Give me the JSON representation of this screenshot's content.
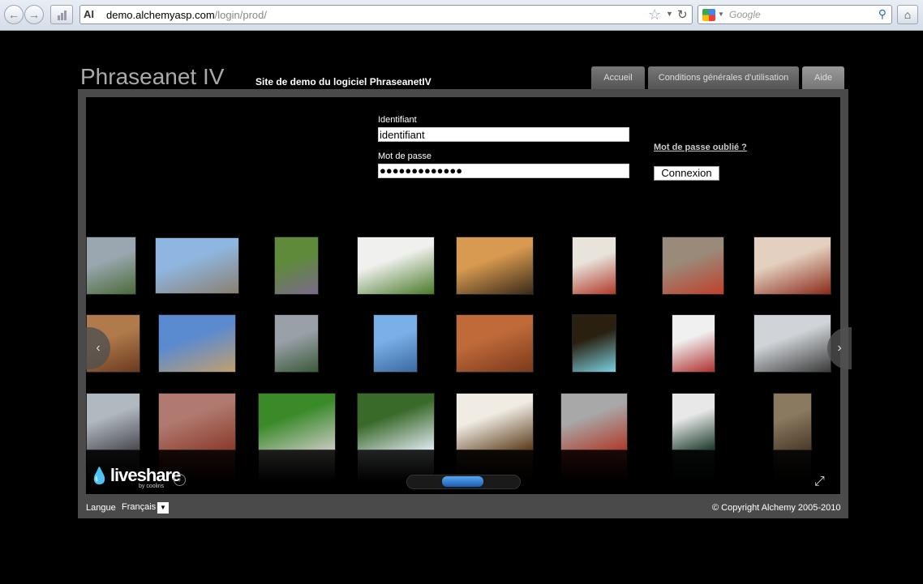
{
  "browser": {
    "url_domain": "demo.alchemyasp.com",
    "url_path": "/login/prod/",
    "site_icon_text": "AI",
    "search_placeholder": "Google"
  },
  "header": {
    "logo": "Phraseanet IV",
    "tagline": "Site de demo du logiciel PhraseanetIV",
    "tabs": [
      "Accueil",
      "Conditions générales d'utilisation",
      "Aide"
    ]
  },
  "login": {
    "id_label": "Identifiant",
    "id_value": "identifiant",
    "pwd_label": "Mot de passe",
    "pwd_value": "●●●●●●●●●●●●●",
    "forgot_link": "Mot de passe oublié ?",
    "submit": "Connexion"
  },
  "wall": {
    "brand": "liveshare",
    "brand_sub": "by cooliris",
    "thumbs": [
      {
        "name": "thumb-park",
        "c1": "#9aa7b0",
        "c2": "#4b6b3a"
      },
      {
        "name": "thumb-castle",
        "c1": "#8fb6e0",
        "c2": "#8a8070"
      },
      {
        "name": "thumb-bamboo-leaves",
        "c1": "#5f8a3a",
        "c2": "#7a6a8a"
      },
      {
        "name": "thumb-white-blossoms",
        "c1": "#f0f0ee",
        "c2": "#4a7a2a"
      },
      {
        "name": "thumb-sunset-trees",
        "c1": "#d89a50",
        "c2": "#3a2a1a"
      },
      {
        "name": "thumb-glass-art",
        "c1": "#e8e4dc",
        "c2": "#b03a2a"
      },
      {
        "name": "thumb-sculpture-red",
        "c1": "#9a8a7a",
        "c2": "#c0402a"
      },
      {
        "name": "thumb-glass-bowl",
        "c1": "#e4d0c0",
        "c2": "#8a2a1a"
      },
      {
        "name": "thumb-building",
        "c1": "#b07a4a",
        "c2": "#6a3a20"
      },
      {
        "name": "thumb-globe",
        "c1": "#5a8ad0",
        "c2": "#c0a070"
      },
      {
        "name": "thumb-paris-column",
        "c1": "#9aa0a8",
        "c2": "#3a5a3a"
      },
      {
        "name": "thumb-windmill",
        "c1": "#7ab0e8",
        "c2": "#3a6aa0"
      },
      {
        "name": "thumb-monument-valley",
        "c1": "#c06a3a",
        "c2": "#7a3a1a"
      },
      {
        "name": "thumb-light-box",
        "c1": "#2a2010",
        "c2": "#7ad0e0"
      },
      {
        "name": "thumb-red-object",
        "c1": "#f0f0f0",
        "c2": "#b03030"
      },
      {
        "name": "thumb-storefront",
        "c1": "#d0d4d8",
        "c2": "#3a3a3a"
      },
      {
        "name": "thumb-skyline",
        "c1": "#b0b8c0",
        "c2": "#4a4a50"
      },
      {
        "name": "thumb-red-flowers",
        "c1": "#b07a70",
        "c2": "#8a3a2a"
      },
      {
        "name": "thumb-park-benches",
        "c1": "#3a8a2a",
        "c2": "#c8c8c0"
      },
      {
        "name": "thumb-waterfall",
        "c1": "#3a6a2a",
        "c2": "#e0e8f0"
      },
      {
        "name": "thumb-cabinet",
        "c1": "#f0ece4",
        "c2": "#5a3a1a"
      },
      {
        "name": "thumb-sculpture-car",
        "c1": "#a8a8a8",
        "c2": "#b03a2a"
      },
      {
        "name": "thumb-glass-vase",
        "c1": "#e8e8e8",
        "c2": "#1a3a2a"
      },
      {
        "name": "thumb-cathedral",
        "c1": "#8a7a60",
        "c2": "#4a3a2a"
      }
    ]
  },
  "footer": {
    "lang_label": "Langue",
    "lang_value": "Français",
    "copyright": "© Copyright Alchemy 2005-2010"
  }
}
